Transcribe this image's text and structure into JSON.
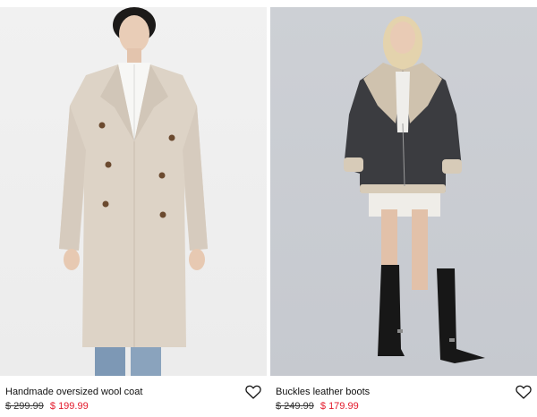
{
  "products": [
    {
      "title": "Handmade oversized wool coat",
      "old_price": "$ 299.99",
      "price": "$ 199.99",
      "favorite_icon": "heart-outline-icon"
    },
    {
      "title": "Buckles leather boots",
      "old_price": "$ 249.99",
      "price": "$ 179.99",
      "favorite_icon": "heart-outline-icon"
    }
  ],
  "colors": {
    "sale_price": "#e3192b",
    "text": "#111111"
  }
}
